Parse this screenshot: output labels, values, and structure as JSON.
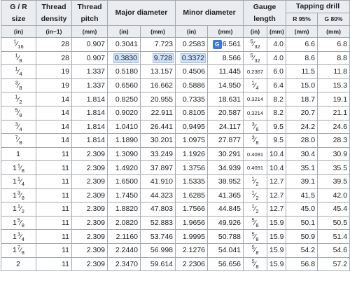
{
  "header": {
    "size": "G / R size",
    "density": "Thread density",
    "pitch": "Thread pitch",
    "major": "Major diameter",
    "minor": "Minor diameter",
    "gauge": "Gauge length",
    "tapping": "Tapping drill",
    "r95": "R 95%",
    "g80": "G 80%"
  },
  "units": {
    "size": "(in)",
    "density": "(in−1)",
    "pitch": "(mm)",
    "major_in": "(in)",
    "major_mm": "(mm)",
    "minor_in": "(in)",
    "minor_mm": "(mm)",
    "gauge_in": "(in)",
    "gauge_mm": "(mm)",
    "r95": "(mm)",
    "g80": "(mm)"
  },
  "rows": [
    {
      "whole": "",
      "num": "1",
      "den": "16",
      "density": "28",
      "pitch": "0.907",
      "major_in": "0.3041",
      "major_mm": "7.723",
      "minor_in": "0.2583",
      "minor_mm": "6.561",
      "g_whole": "",
      "g_num": "5",
      "g_den": "32",
      "g_dec": "",
      "gauge_mm": "4.0",
      "r95": "6.6",
      "g80": "6.8"
    },
    {
      "whole": "",
      "num": "1",
      "den": "8",
      "density": "28",
      "pitch": "0.907",
      "major_in": "0.3830",
      "major_mm": "9.728",
      "minor_in": "0.3372",
      "minor_mm": "8.566",
      "g_whole": "",
      "g_num": "5",
      "g_den": "32",
      "g_dec": "",
      "gauge_mm": "4.0",
      "r95": "8.6",
      "g80": "8.8"
    },
    {
      "whole": "",
      "num": "1",
      "den": "4",
      "density": "19",
      "pitch": "1.337",
      "major_in": "0.5180",
      "major_mm": "13.157",
      "minor_in": "0.4506",
      "minor_mm": "11.445",
      "g_whole": "",
      "g_num": "",
      "g_den": "",
      "g_dec": "0.2367",
      "gauge_mm": "6.0",
      "r95": "11.5",
      "g80": "11.8"
    },
    {
      "whole": "",
      "num": "3",
      "den": "8",
      "density": "19",
      "pitch": "1.337",
      "major_in": "0.6560",
      "major_mm": "16.662",
      "minor_in": "0.5886",
      "minor_mm": "14.950",
      "g_whole": "",
      "g_num": "1",
      "g_den": "4",
      "g_dec": "",
      "gauge_mm": "6.4",
      "r95": "15.0",
      "g80": "15.3"
    },
    {
      "whole": "",
      "num": "1",
      "den": "2",
      "density": "14",
      "pitch": "1.814",
      "major_in": "0.8250",
      "major_mm": "20.955",
      "minor_in": "0.7335",
      "minor_mm": "18.631",
      "g_whole": "",
      "g_num": "",
      "g_den": "",
      "g_dec": "0.3214",
      "gauge_mm": "8.2",
      "r95": "18.7",
      "g80": "19.1"
    },
    {
      "whole": "",
      "num": "5",
      "den": "8",
      "density": "14",
      "pitch": "1.814",
      "major_in": "0.9020",
      "major_mm": "22.911",
      "minor_in": "0.8105",
      "minor_mm": "20.587",
      "g_whole": "",
      "g_num": "",
      "g_den": "",
      "g_dec": "0.3214",
      "gauge_mm": "8.2",
      "r95": "20.7",
      "g80": "21.1"
    },
    {
      "whole": "",
      "num": "3",
      "den": "4",
      "density": "14",
      "pitch": "1.814",
      "major_in": "1.0410",
      "major_mm": "26.441",
      "minor_in": "0.9495",
      "minor_mm": "24.117",
      "g_whole": "",
      "g_num": "3",
      "g_den": "8",
      "g_dec": "",
      "gauge_mm": "9.5",
      "r95": "24.2",
      "g80": "24.6"
    },
    {
      "whole": "",
      "num": "7",
      "den": "8",
      "density": "14",
      "pitch": "1.814",
      "major_in": "1.1890",
      "major_mm": "30.201",
      "minor_in": "1.0975",
      "minor_mm": "27.877",
      "g_whole": "",
      "g_num": "3",
      "g_den": "8",
      "g_dec": "",
      "gauge_mm": "9.5",
      "r95": "28.0",
      "g80": "28.3"
    },
    {
      "whole": "1",
      "num": "",
      "den": "",
      "density": "11",
      "pitch": "2.309",
      "major_in": "1.3090",
      "major_mm": "33.249",
      "minor_in": "1.1926",
      "minor_mm": "30.291",
      "g_whole": "",
      "g_num": "",
      "g_den": "",
      "g_dec": "0.4091",
      "gauge_mm": "10.4",
      "r95": "30.4",
      "g80": "30.9"
    },
    {
      "whole": "1",
      "num": "1",
      "den": "8",
      "density": "11",
      "pitch": "2.309",
      "major_in": "1.4920",
      "major_mm": "37.897",
      "minor_in": "1.3756",
      "minor_mm": "34.939",
      "g_whole": "",
      "g_num": "",
      "g_den": "",
      "g_dec": "0.4091",
      "gauge_mm": "10.4",
      "r95": "35.1",
      "g80": "35.5"
    },
    {
      "whole": "1",
      "num": "1",
      "den": "4",
      "density": "11",
      "pitch": "2.309",
      "major_in": "1.6500",
      "major_mm": "41.910",
      "minor_in": "1.5335",
      "minor_mm": "38.952",
      "g_whole": "",
      "g_num": "1",
      "g_den": "2",
      "g_dec": "",
      "gauge_mm": "12.7",
      "r95": "39.1",
      "g80": "39.5"
    },
    {
      "whole": "1",
      "num": "3",
      "den": "8",
      "density": "11",
      "pitch": "2.309",
      "major_in": "1.7450",
      "major_mm": "44.323",
      "minor_in": "1.6285",
      "minor_mm": "41.365",
      "g_whole": "",
      "g_num": "1",
      "g_den": "2",
      "g_dec": "",
      "gauge_mm": "12.7",
      "r95": "41.5",
      "g80": "42.0"
    },
    {
      "whole": "1",
      "num": "1",
      "den": "2",
      "density": "11",
      "pitch": "2.309",
      "major_in": "1.8820",
      "major_mm": "47.803",
      "minor_in": "1.7566",
      "minor_mm": "44.845",
      "g_whole": "",
      "g_num": "1",
      "g_den": "2",
      "g_dec": "",
      "gauge_mm": "12.7",
      "r95": "45.0",
      "g80": "45.4"
    },
    {
      "whole": "1",
      "num": "5",
      "den": "8",
      "density": "11",
      "pitch": "2.309",
      "major_in": "2.0820",
      "major_mm": "52.883",
      "minor_in": "1.9656",
      "minor_mm": "49.926",
      "g_whole": "",
      "g_num": "5",
      "g_den": "8",
      "g_dec": "",
      "gauge_mm": "15.9",
      "r95": "50.1",
      "g80": "50.5"
    },
    {
      "whole": "1",
      "num": "3",
      "den": "4",
      "density": "11",
      "pitch": "2.309",
      "major_in": "2.1160",
      "major_mm": "53.746",
      "minor_in": "1.9995",
      "minor_mm": "50.788",
      "g_whole": "",
      "g_num": "5",
      "g_den": "8",
      "g_dec": "",
      "gauge_mm": "15.9",
      "r95": "50.9",
      "g80": "51.4"
    },
    {
      "whole": "1",
      "num": "7",
      "den": "8",
      "density": "11",
      "pitch": "2.309",
      "major_in": "2.2440",
      "major_mm": "56.998",
      "minor_in": "2.1276",
      "minor_mm": "54.041",
      "g_whole": "",
      "g_num": "5",
      "g_den": "8",
      "g_dec": "",
      "gauge_mm": "15.9",
      "r95": "54.2",
      "g80": "54.6"
    },
    {
      "whole": "2",
      "num": "",
      "den": "",
      "density": "11",
      "pitch": "2.309",
      "major_in": "2.3470",
      "major_mm": "59.614",
      "minor_in": "2.2306",
      "minor_mm": "56.656",
      "g_whole": "",
      "g_num": "5",
      "g_den": "8",
      "g_dec": "",
      "gauge_mm": "15.9",
      "r95": "56.8",
      "g80": "57.2"
    }
  ],
  "highlight": {
    "row": 1,
    "cells": [
      "major_in",
      "major_mm",
      "minor_in"
    ]
  },
  "translate_icon": {
    "icon": "translate-icon",
    "label": "G",
    "row": 0,
    "color": "#3b78e7"
  }
}
